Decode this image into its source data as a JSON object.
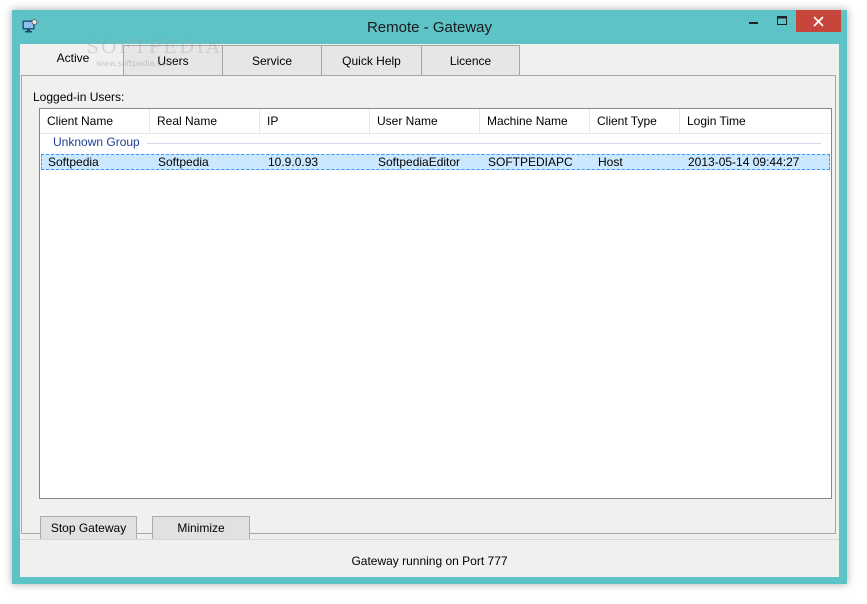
{
  "window": {
    "title": "Remote - Gateway",
    "accent_color": "#5ec3c6"
  },
  "tabs": [
    "Active",
    "Users",
    "Service",
    "Quick Help",
    "Licence"
  ],
  "active_tab": "Active",
  "panel": {
    "label": "Logged-in Users:"
  },
  "table": {
    "columns": [
      "Client Name",
      "Real Name",
      "IP",
      "User Name",
      "Machine Name",
      "Client Type",
      "Login Time"
    ],
    "group": "Unknown Group",
    "rows": [
      [
        "Softpedia",
        "Softpedia",
        "10.9.0.93",
        "SoftpediaEditor",
        "SOFTPEDIAPC",
        "Host",
        "2013-05-14 09:44:27"
      ]
    ]
  },
  "buttons": {
    "stop": "Stop Gateway",
    "minimize": "Minimize"
  },
  "status": "Gateway running on Port 777",
  "watermark": {
    "text": "SOFTPEDIA",
    "url": "www.softpedia.com"
  }
}
